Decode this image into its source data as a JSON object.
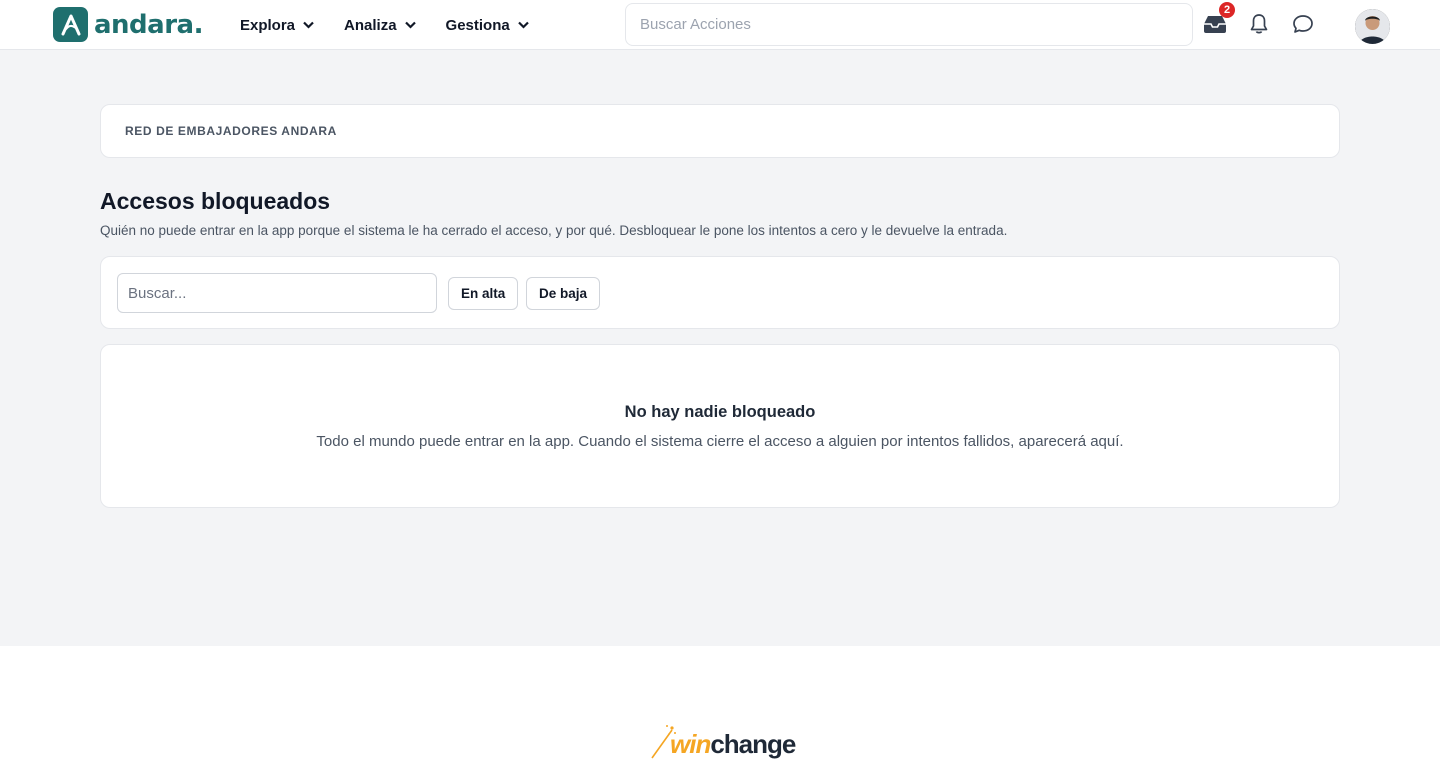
{
  "header": {
    "logo_text": "andara.",
    "nav": [
      {
        "label": "Explora"
      },
      {
        "label": "Analiza"
      },
      {
        "label": "Gestiona"
      }
    ],
    "search_placeholder": "Buscar Acciones",
    "inbox_badge": "2"
  },
  "breadcrumb": "RED DE EMBAJADORES ANDARA",
  "page": {
    "title": "Accesos bloqueados",
    "subtitle": "Quién no puede entrar en la app porque el sistema le ha cerrado el acceso, y por qué. Desbloquear le pone los intentos a cero y le devuelve la entrada."
  },
  "filters": {
    "search_placeholder": "Buscar...",
    "chips": [
      "En alta",
      "De baja"
    ]
  },
  "empty_state": {
    "title": "No hay nadie bloqueado",
    "description": "Todo el mundo puede entrar en la app. Cuando el sistema cierre el acceso a alguien por intentos fallidos, aparecerá aquí."
  },
  "footer": {
    "logo_win": "win",
    "logo_change": "change"
  },
  "colors": {
    "brand": "#1f6f6e",
    "badge": "#dc2626",
    "page_bg": "#f3f4f6"
  }
}
